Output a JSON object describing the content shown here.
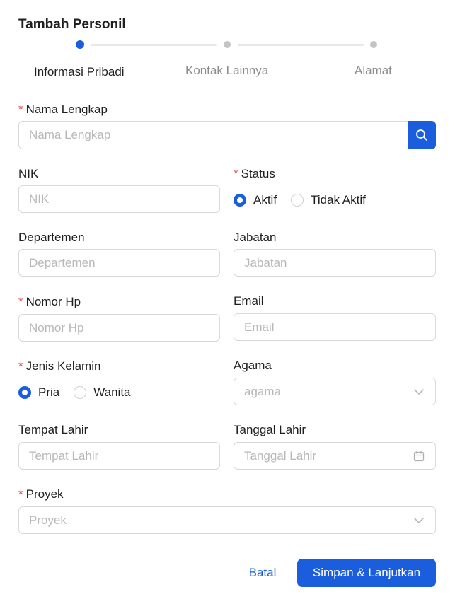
{
  "dialog": {
    "title": "Tambah Personil"
  },
  "stepper": {
    "steps": [
      {
        "label": "Informasi Pribadi",
        "state": "active"
      },
      {
        "label": "Kontak Lainnya",
        "state": "inactive"
      },
      {
        "label": "Alamat",
        "state": "inactive"
      }
    ],
    "active_color": "#1a5ede"
  },
  "fields": {
    "nama_lengkap": {
      "label": "Nama Lengkap",
      "required": true,
      "placeholder": "Nama Lengkap",
      "value": ""
    },
    "nik": {
      "label": "NIK",
      "required": false,
      "placeholder": "NIK",
      "value": ""
    },
    "status": {
      "label": "Status",
      "required": true,
      "options": [
        "Aktif",
        "Tidak Aktif"
      ],
      "selected": "Aktif"
    },
    "departemen": {
      "label": "Departemen",
      "required": false,
      "placeholder": "Departemen",
      "value": ""
    },
    "jabatan": {
      "label": "Jabatan",
      "required": false,
      "placeholder": "Jabatan",
      "value": ""
    },
    "nomor_hp": {
      "label": "Nomor Hp",
      "required": true,
      "placeholder": "Nomor Hp",
      "value": ""
    },
    "email": {
      "label": "Email",
      "required": false,
      "placeholder": "Email",
      "value": ""
    },
    "jenis_kelamin": {
      "label": "Jenis Kelamin",
      "required": true,
      "options": [
        "Pria",
        "Wanita"
      ],
      "selected": "Pria"
    },
    "agama": {
      "label": "Agama",
      "required": false,
      "placeholder": "agama"
    },
    "tempat_lahir": {
      "label": "Tempat Lahir",
      "required": false,
      "placeholder": "Tempat Lahir",
      "value": ""
    },
    "tanggal_lahir": {
      "label": "Tanggal Lahir",
      "required": false,
      "placeholder": "Tanggal Lahir",
      "value": ""
    },
    "proyek": {
      "label": "Proyek",
      "required": true,
      "placeholder": "Proyek"
    }
  },
  "required_marker": "*",
  "actions": {
    "cancel_label": "Batal",
    "submit_label": "Simpan & Lanjutkan"
  },
  "icons": {
    "search_button": "search-icon",
    "select_suffix": "chevron-down-icon",
    "date_suffix": "calendar-icon"
  },
  "colors": {
    "primary": "#1a5ede",
    "required": "#e34d4d",
    "placeholder": "#b8b8b8",
    "border": "#d9d9d9"
  }
}
